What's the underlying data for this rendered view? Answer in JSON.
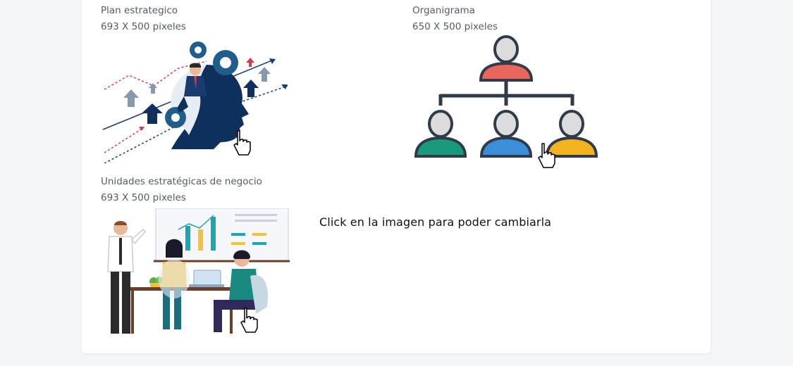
{
  "items": [
    {
      "title": "Plan estrategico",
      "dims": "693 X 500 pixeles"
    },
    {
      "title": "Organigrama",
      "dims": "650 X 500 pixeles"
    },
    {
      "title": "Unidades estratégicas de negocio",
      "dims": "693 X 500 pixeles"
    }
  ],
  "hint": "Click en la imagen para poder cambiarla",
  "icons": {
    "cursor": "hand-pointer-icon"
  },
  "colors": {
    "background": "#f4f5f9",
    "card": "#ffffff",
    "navy": "#0f2f5c",
    "gear": "#1f5d8c",
    "org_red": "#e8665a",
    "org_green": "#1a9a7c",
    "org_blue": "#3b8ed8",
    "org_yellow": "#f3b321",
    "org_line": "#2f3b48"
  }
}
